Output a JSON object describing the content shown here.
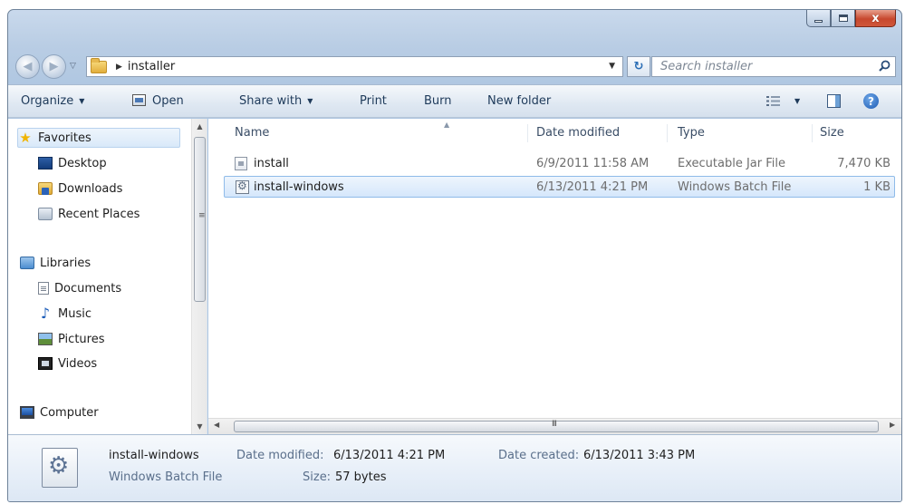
{
  "window": {
    "title": "installer"
  },
  "caption": {
    "minimize": "–",
    "maximize": "□",
    "close": "x"
  },
  "address": {
    "path": "installer"
  },
  "search": {
    "placeholder": "Search installer"
  },
  "toolbar": {
    "organize": "Organize",
    "open": "Open",
    "share_with": "Share with",
    "print": "Print",
    "burn": "Burn",
    "new_folder": "New folder",
    "help": "?"
  },
  "nav": {
    "favorites": "Favorites",
    "desktop": "Desktop",
    "downloads": "Downloads",
    "recent_places": "Recent Places",
    "libraries": "Libraries",
    "documents": "Documents",
    "music": "Music",
    "pictures": "Pictures",
    "videos": "Videos",
    "computer": "Computer"
  },
  "columns": {
    "name": "Name",
    "date": "Date modified",
    "type": "Type",
    "size": "Size"
  },
  "files": [
    {
      "name": "install",
      "date": "6/9/2011 11:58 AM",
      "type": "Executable Jar File",
      "size": "7,470 KB"
    },
    {
      "name": "install-windows",
      "date": "6/13/2011 4:21 PM",
      "type": "Windows Batch File",
      "size": "1 KB"
    }
  ],
  "scroll": {
    "grip": "III"
  },
  "details": {
    "name": "install-windows",
    "kind": "Windows Batch File",
    "modified_label": "Date modified:",
    "modified_value": "6/13/2011 4:21 PM",
    "size_label": "Size:",
    "size_value": "57 bytes",
    "created_label": "Date created:",
    "created_value": "6/13/2011 3:43 PM"
  }
}
